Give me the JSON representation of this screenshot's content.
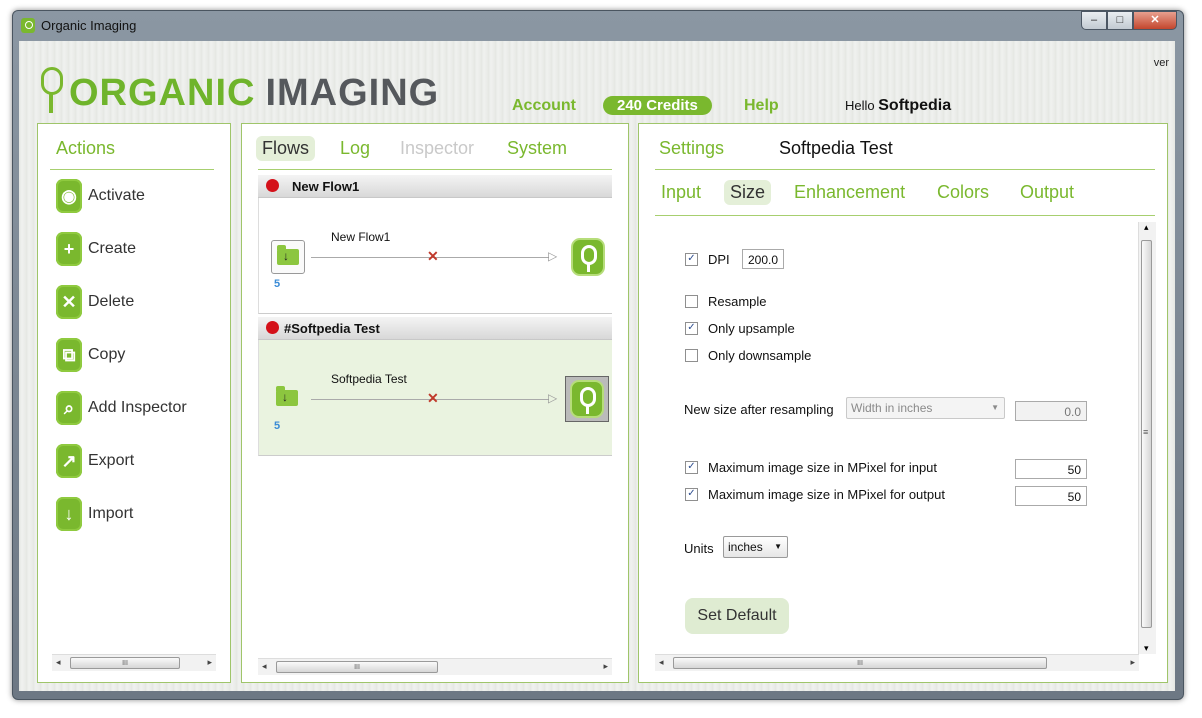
{
  "window": {
    "title": "Organic Imaging",
    "minimize": "–",
    "maximize": "□",
    "close": "✕"
  },
  "header": {
    "logo_word1": "ORGANIC",
    "logo_word2": "IMAGING",
    "account": "Account",
    "credits": "240 Credits",
    "help": "Help",
    "hello": "Hello",
    "username": "Softpedia",
    "ver": "ver"
  },
  "actions": {
    "title": "Actions",
    "items": [
      {
        "label": "Activate",
        "icon": "power-icon",
        "glyph": "◉"
      },
      {
        "label": "Create",
        "icon": "plus-icon",
        "glyph": "+"
      },
      {
        "label": "Delete",
        "icon": "x-icon",
        "glyph": "✕"
      },
      {
        "label": "Copy",
        "icon": "copy-icon",
        "glyph": "⧉"
      },
      {
        "label": "Add Inspector",
        "icon": "magnifier-icon",
        "glyph": "⌕"
      },
      {
        "label": "Export",
        "icon": "export-arrow-icon",
        "glyph": "↗"
      },
      {
        "label": "Import",
        "icon": "import-arrow-icon",
        "glyph": "↓"
      }
    ]
  },
  "flows_panel": {
    "tabs": [
      "Flows",
      "Log",
      "Inspector",
      "System"
    ],
    "flows": [
      {
        "header": "New Flow1",
        "name": "New Flow1",
        "count": "5"
      },
      {
        "header": "#Softpedia Test",
        "name": "Softpedia Test",
        "count": "5"
      }
    ]
  },
  "settings_panel": {
    "title": "Settings",
    "name": "Softpedia Test",
    "tabs": [
      "Input",
      "Size",
      "Enhancement",
      "Colors",
      "Output"
    ],
    "dpi_label": "DPI",
    "dpi_value": "200.0",
    "resample_label": "Resample",
    "only_up_label": "Only upsample",
    "only_down_label": "Only downsample",
    "new_size_label": "New size after resampling",
    "new_size_select": "Width in inches",
    "new_size_value": "0.0",
    "max_input_label": "Maximum image size in MPixel for input",
    "max_input_value": "50",
    "max_output_label": "Maximum image size in MPixel for output",
    "max_output_value": "50",
    "units_label": "Units",
    "units_value": "inches",
    "set_default": "Set Default",
    "checks": {
      "dpi": true,
      "resample": false,
      "only_up": true,
      "only_down": false,
      "max_input": true,
      "max_output": true
    }
  },
  "scroll": {
    "left": "◂",
    "right": "▸",
    "up": "▴",
    "down": "▾",
    "grip": "III",
    "vgrip": "≡"
  },
  "colors": {
    "accent": "#7ab82e",
    "flow_dot": "#d4111a",
    "count": "#3a8bd6"
  }
}
